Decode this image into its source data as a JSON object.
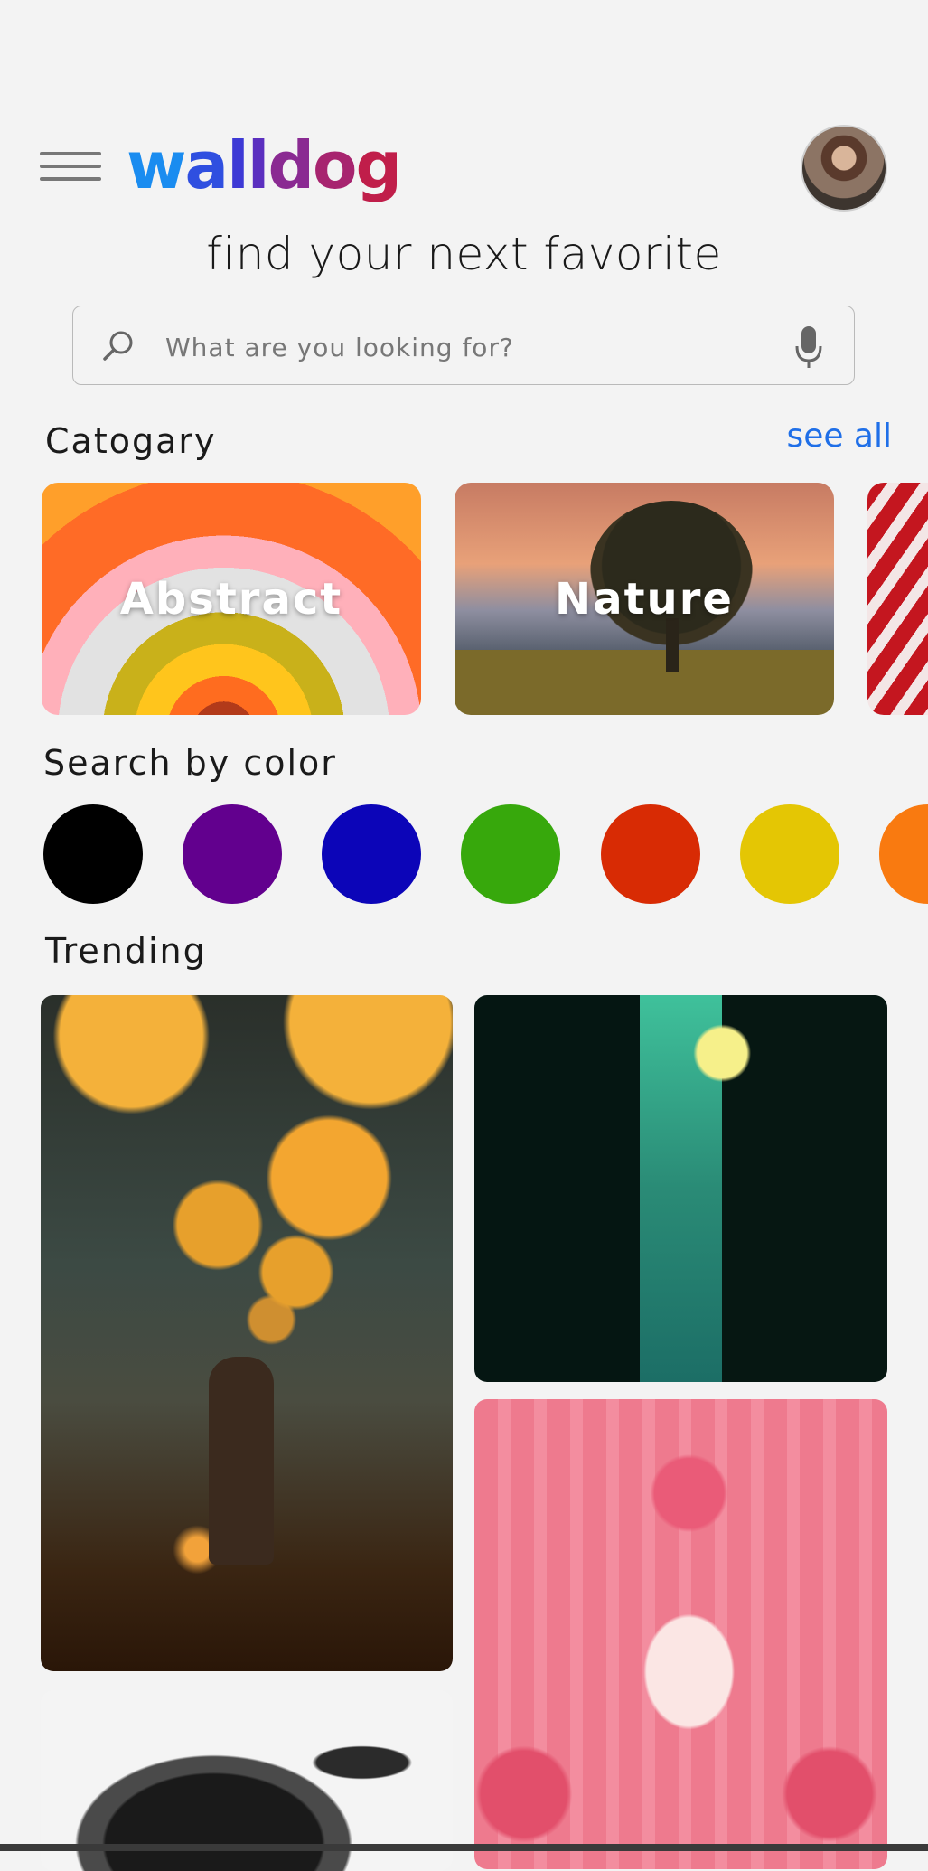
{
  "app": {
    "logo": {
      "w": "w",
      "a": "a",
      "l1": "l",
      "l2": "l",
      "d": "d",
      "o": "o",
      "g": "g"
    }
  },
  "header": {
    "menu_icon": "hamburger-menu-icon",
    "avatar_icon": "user-avatar"
  },
  "tagline": "find your next favorite",
  "search": {
    "placeholder": "What are you looking for?",
    "value": "",
    "search_icon": "search-icon",
    "mic_icon": "microphone-icon"
  },
  "categories": {
    "title": "Catogary",
    "see_all": "see all",
    "items": [
      {
        "label": "Abstract"
      },
      {
        "label": "Nature"
      },
      {
        "label": ""
      }
    ]
  },
  "colors": {
    "title": "Search by color",
    "swatches": [
      "#000000",
      "#62008e",
      "#0c05b8",
      "#37a80c",
      "#d82b04",
      "#e4c604",
      "#f97a10"
    ]
  },
  "trending": {
    "title": "Trending"
  }
}
